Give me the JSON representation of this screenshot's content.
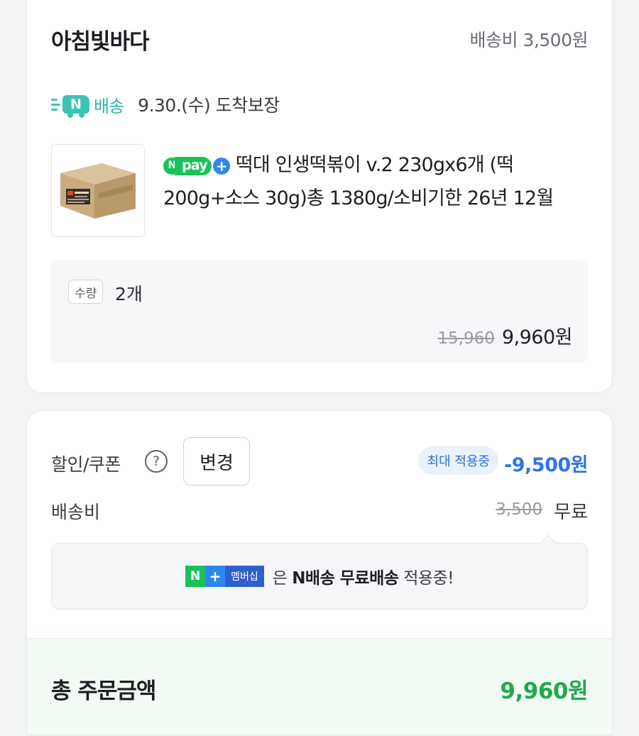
{
  "store": {
    "name": "아침빛바다",
    "shipping_fee": "배송비 3,500원"
  },
  "delivery": {
    "n_logo": "N",
    "label": "배송",
    "date": "9.30.(수) 도착보장"
  },
  "product": {
    "npay_n": "N",
    "npay_label": "pay",
    "npay_plus": "+",
    "title": "떡대 인생떡볶이 v.2 230gx6개 (떡200g+소스 30g)총 1380g/소비기한 26년 12월",
    "quantity_label": "수량",
    "quantity_value": "2개",
    "original_price": "15,960",
    "sale_price": "9,960원"
  },
  "discount": {
    "label": "할인/쿠폰",
    "help": "?",
    "change_button": "변경",
    "badge": "최대 적용중",
    "amount": "-9,500원"
  },
  "shipping": {
    "label": "배송비",
    "original": "3,500",
    "value": "무료"
  },
  "membership": {
    "badge_n": "N",
    "badge_plus": "+",
    "badge_text": "멤버십",
    "text_pre": "은",
    "text_bold": "N배송 무료배송",
    "text_post": "적용중!"
  },
  "total": {
    "label": "총 주문금액",
    "value": "9,960원"
  },
  "colors": {
    "accent_green": "#21a84c",
    "nship_teal": "#3cc4b2",
    "discount_blue": "#2f75e6"
  }
}
